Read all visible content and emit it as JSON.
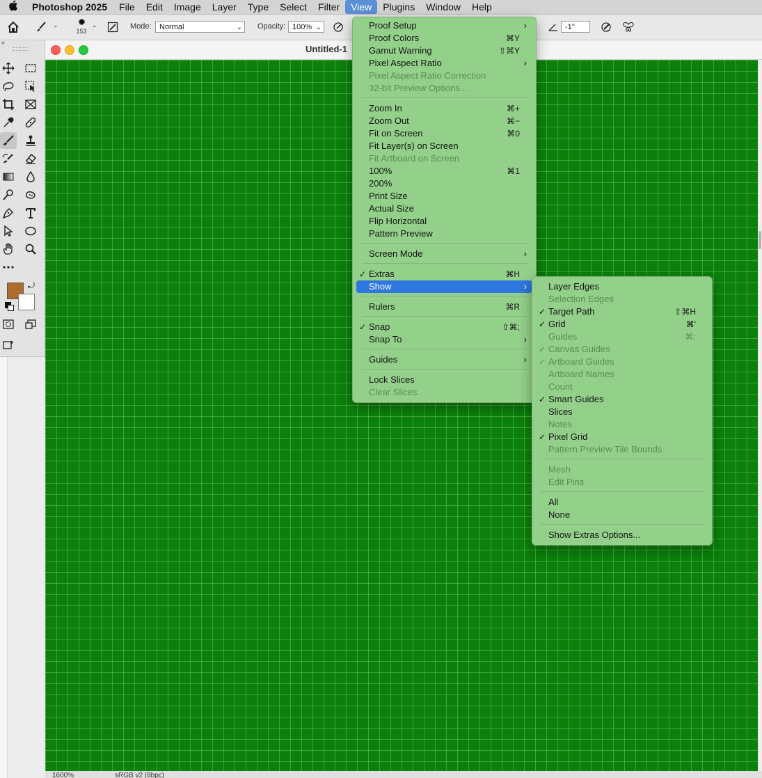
{
  "menubar": {
    "apple": "",
    "items": [
      "Photoshop 2025",
      "File",
      "Edit",
      "Image",
      "Layer",
      "Type",
      "Select",
      "Filter",
      "View",
      "Plugins",
      "Window",
      "Help"
    ],
    "active": "View"
  },
  "options": {
    "brush_size": "153",
    "mode_label": "Mode:",
    "mode_value": "Normal",
    "opacity_label": "Opacity:",
    "opacity_value": "100%",
    "angle_value": "-1°"
  },
  "document": {
    "title": "Untitled-1",
    "zoom": "1600%",
    "profile": "sRGB v2 (8bpc)",
    "grid_color": "#0b800b"
  },
  "colors": {
    "foreground": "#b06a2a",
    "background": "#ffffff",
    "menu_bg": "#93d08a",
    "highlight": "#2f76e0"
  },
  "view_menu": [
    {
      "label": "Proof Setup",
      "submenu": true
    },
    {
      "label": "Proof Colors",
      "shortcut": "⌘Y"
    },
    {
      "label": "Gamut Warning",
      "shortcut": "⇧⌘Y"
    },
    {
      "label": "Pixel Aspect Ratio",
      "submenu": true
    },
    {
      "label": "Pixel Aspect Ratio Correction",
      "disabled": true
    },
    {
      "label": "32-bit Preview Options...",
      "disabled": true
    },
    {
      "sep": true
    },
    {
      "label": "Zoom In",
      "shortcut": "⌘+"
    },
    {
      "label": "Zoom Out",
      "shortcut": "⌘−"
    },
    {
      "label": "Fit on Screen",
      "shortcut": "⌘0"
    },
    {
      "label": "Fit Layer(s) on Screen"
    },
    {
      "label": "Fit Artboard on Screen",
      "disabled": true
    },
    {
      "label": "100%",
      "shortcut": "⌘1"
    },
    {
      "label": "200%"
    },
    {
      "label": "Print Size"
    },
    {
      "label": "Actual Size"
    },
    {
      "label": "Flip Horizontal"
    },
    {
      "label": "Pattern Preview"
    },
    {
      "sep": true
    },
    {
      "label": "Screen Mode",
      "submenu": true
    },
    {
      "sep": true
    },
    {
      "label": "Extras",
      "shortcut": "⌘H",
      "checked": true
    },
    {
      "label": "Show",
      "submenu": true,
      "highlighted": true
    },
    {
      "sep": true
    },
    {
      "label": "Rulers",
      "shortcut": "⌘R"
    },
    {
      "sep": true
    },
    {
      "label": "Snap",
      "shortcut": "⇧⌘;",
      "checked": true
    },
    {
      "label": "Snap To",
      "submenu": true
    },
    {
      "sep": true
    },
    {
      "label": "Guides",
      "submenu": true
    },
    {
      "sep": true
    },
    {
      "label": "Lock Slices"
    },
    {
      "label": "Clear Slices",
      "disabled": true
    }
  ],
  "show_menu": [
    {
      "label": "Layer Edges"
    },
    {
      "label": "Selection Edges",
      "disabled": true
    },
    {
      "label": "Target Path",
      "shortcut": "⇧⌘H",
      "checked": true
    },
    {
      "label": "Grid",
      "shortcut": "⌘'",
      "checked": true
    },
    {
      "label": "Guides",
      "shortcut": "⌘;",
      "disabled": true
    },
    {
      "label": "Canvas Guides",
      "checked": true,
      "disabled": true
    },
    {
      "label": "Artboard Guides",
      "checked": true,
      "disabled": true
    },
    {
      "label": "Artboard Names",
      "disabled": true
    },
    {
      "label": "Count",
      "disabled": true
    },
    {
      "label": "Smart Guides",
      "checked": true
    },
    {
      "label": "Slices"
    },
    {
      "label": "Notes",
      "disabled": true
    },
    {
      "label": "Pixel Grid",
      "checked": true
    },
    {
      "label": "Pattern Preview Tile Bounds",
      "disabled": true
    },
    {
      "sep": true
    },
    {
      "label": "Mesh",
      "disabled": true
    },
    {
      "label": "Edit Pins",
      "disabled": true
    },
    {
      "sep": true
    },
    {
      "label": "All"
    },
    {
      "label": "None"
    },
    {
      "sep": true
    },
    {
      "label": "Show Extras Options..."
    }
  ]
}
